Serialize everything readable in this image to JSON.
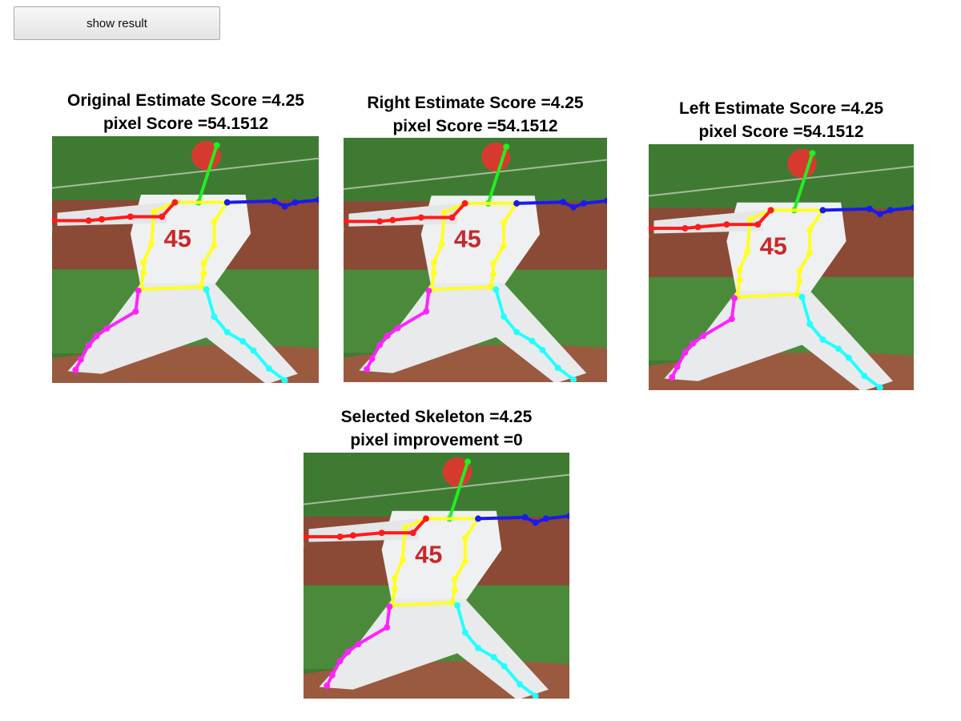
{
  "controls": {
    "show_result_label": "show result"
  },
  "panels": [
    {
      "title_line1": "Original Estimate Score =4.25",
      "title_line2": "pixel Score =54.1512"
    },
    {
      "title_line1": "Right Estimate Score =4.25",
      "title_line2": "pixel Score =54.1512"
    },
    {
      "title_line1": "Left Estimate Score =4.25",
      "title_line2": "pixel Score =54.1512"
    },
    {
      "title_line1": "Selected Skeleton =4.25",
      "title_line2": "pixel improvement =0"
    }
  ],
  "skeleton_colors": {
    "head": "#22ee22",
    "torso": "#ffff22",
    "right_arm": "#ff1a1a",
    "left_arm": "#1a1aee",
    "right_leg": "#ff22ff",
    "left_leg": "#22ffff"
  },
  "jersey_number": "45"
}
